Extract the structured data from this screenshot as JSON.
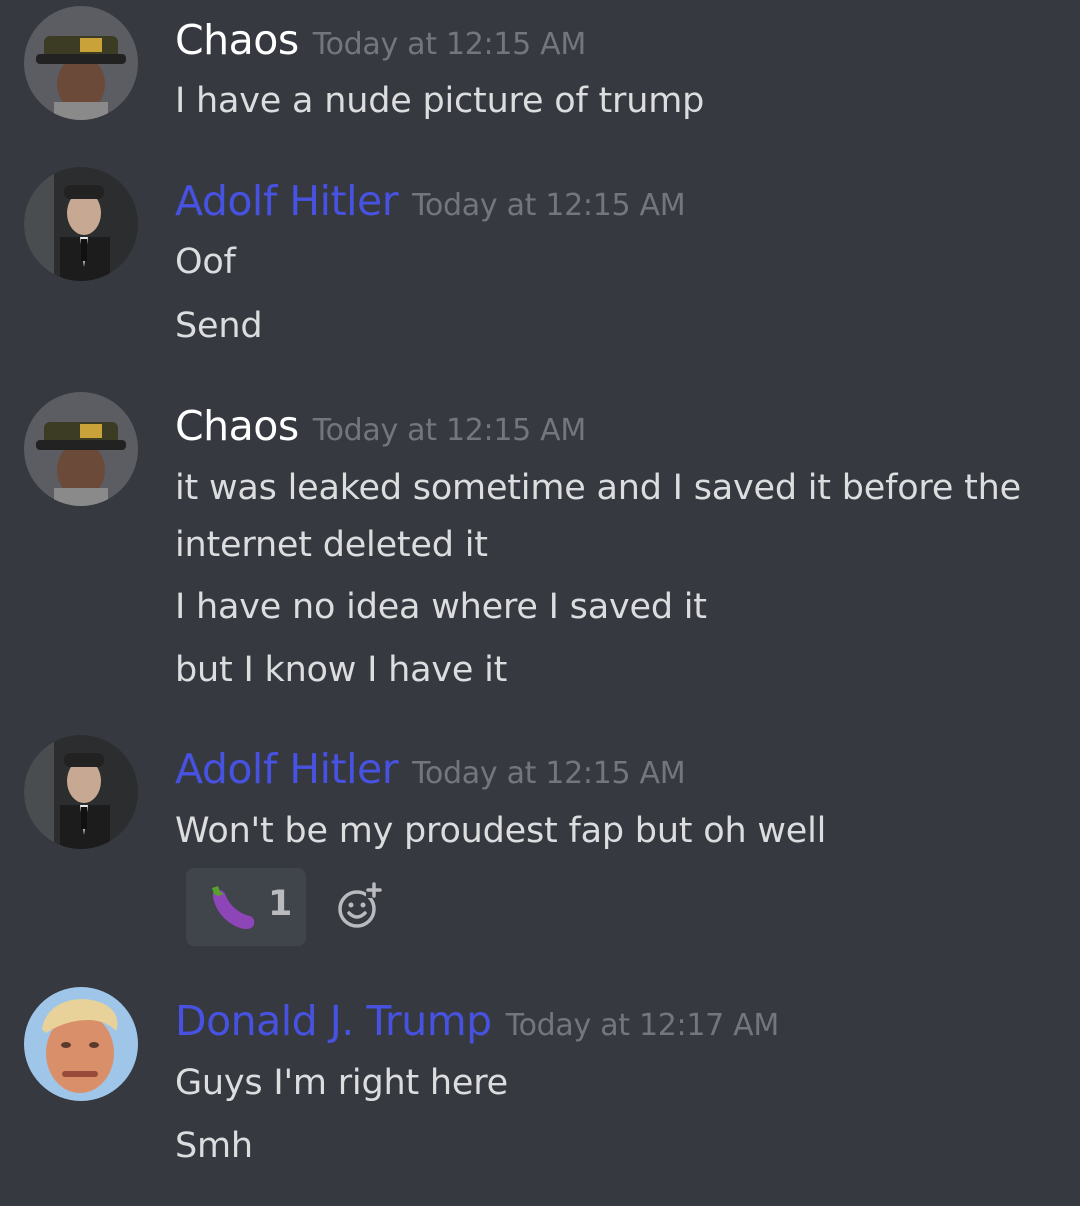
{
  "colors": {
    "background": "#36393f",
    "chaos_name": "#ffffff",
    "hitler_name": "#4752e0",
    "trump_name": "#4752e0",
    "timestamp": "#72767d",
    "message_text": "#dcddde",
    "reaction_bg": "#40444b"
  },
  "messages": [
    {
      "author": "Chaos",
      "timestamp": "Today at 12:15 AM",
      "avatar_icon": "chaos-avatar",
      "lines": [
        "I have a nude picture of trump"
      ]
    },
    {
      "author": "Adolf Hitler",
      "timestamp": "Today at 12:15 AM",
      "avatar_icon": "hitler-avatar",
      "lines": [
        "Oof",
        "Send"
      ]
    },
    {
      "author": "Chaos",
      "timestamp": "Today at 12:15 AM",
      "avatar_icon": "chaos-avatar",
      "lines": [
        "it was leaked sometime and I saved it before the",
        "internet deleted it",
        "I have no idea where I saved it",
        "but I know I have it"
      ]
    },
    {
      "author": "Adolf Hitler",
      "timestamp": "Today at 12:15 AM",
      "avatar_icon": "hitler-avatar",
      "lines": [
        "Won't be my proudest fap but oh well"
      ],
      "reaction": {
        "emoji": "eggplant-icon",
        "count": "1"
      }
    },
    {
      "author": "Donald J. Trump",
      "timestamp": "Today at 12:17 AM",
      "avatar_icon": "trump-avatar",
      "lines": [
        "Guys I'm right here",
        "Smh"
      ]
    }
  ]
}
